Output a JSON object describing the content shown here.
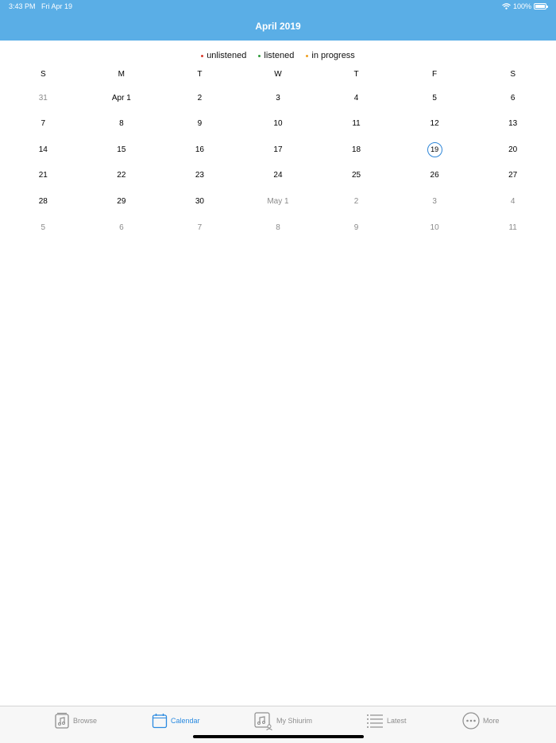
{
  "status": {
    "time": "3:43 PM",
    "date": "Fri Apr 19",
    "battery": "100%"
  },
  "header": {
    "title": "April 2019"
  },
  "legend": [
    {
      "label": "unlistened",
      "color": "#d93a2b"
    },
    {
      "label": "listened",
      "color": "#2e9b3a"
    },
    {
      "label": "in progress",
      "color": "#f0a020"
    }
  ],
  "weekdays": [
    "S",
    "M",
    "T",
    "W",
    "T",
    "F",
    "S"
  ],
  "weeks": [
    [
      {
        "label": "31",
        "other": true
      },
      {
        "label": "Apr 1"
      },
      {
        "label": "2"
      },
      {
        "label": "3"
      },
      {
        "label": "4"
      },
      {
        "label": "5"
      },
      {
        "label": "6"
      }
    ],
    [
      {
        "label": "7"
      },
      {
        "label": "8"
      },
      {
        "label": "9"
      },
      {
        "label": "10"
      },
      {
        "label": "11"
      },
      {
        "label": "12"
      },
      {
        "label": "13"
      }
    ],
    [
      {
        "label": "14"
      },
      {
        "label": "15"
      },
      {
        "label": "16"
      },
      {
        "label": "17"
      },
      {
        "label": "18"
      },
      {
        "label": "19",
        "today": true
      },
      {
        "label": "20"
      }
    ],
    [
      {
        "label": "21"
      },
      {
        "label": "22"
      },
      {
        "label": "23"
      },
      {
        "label": "24"
      },
      {
        "label": "25"
      },
      {
        "label": "26"
      },
      {
        "label": "27"
      }
    ],
    [
      {
        "label": "28"
      },
      {
        "label": "29"
      },
      {
        "label": "30"
      },
      {
        "label": "May 1",
        "other": true
      },
      {
        "label": "2",
        "other": true
      },
      {
        "label": "3",
        "other": true
      },
      {
        "label": "4",
        "other": true
      }
    ],
    [
      {
        "label": "5",
        "other": true
      },
      {
        "label": "6",
        "other": true
      },
      {
        "label": "7",
        "other": true
      },
      {
        "label": "8",
        "other": true
      },
      {
        "label": "9",
        "other": true
      },
      {
        "label": "10",
        "other": true
      },
      {
        "label": "11",
        "other": true
      }
    ]
  ],
  "tabs": [
    {
      "label": "Browse",
      "icon": "music-note-icon",
      "active": false
    },
    {
      "label": "Calendar",
      "icon": "calendar-icon",
      "active": true
    },
    {
      "label": "My Shiurim",
      "icon": "music-person-icon",
      "active": false
    },
    {
      "label": "Latest",
      "icon": "list-icon",
      "active": false
    },
    {
      "label": "More",
      "icon": "more-icon",
      "active": false
    }
  ],
  "colors": {
    "header": "#5aaee6",
    "accent": "#2a8ae0"
  }
}
